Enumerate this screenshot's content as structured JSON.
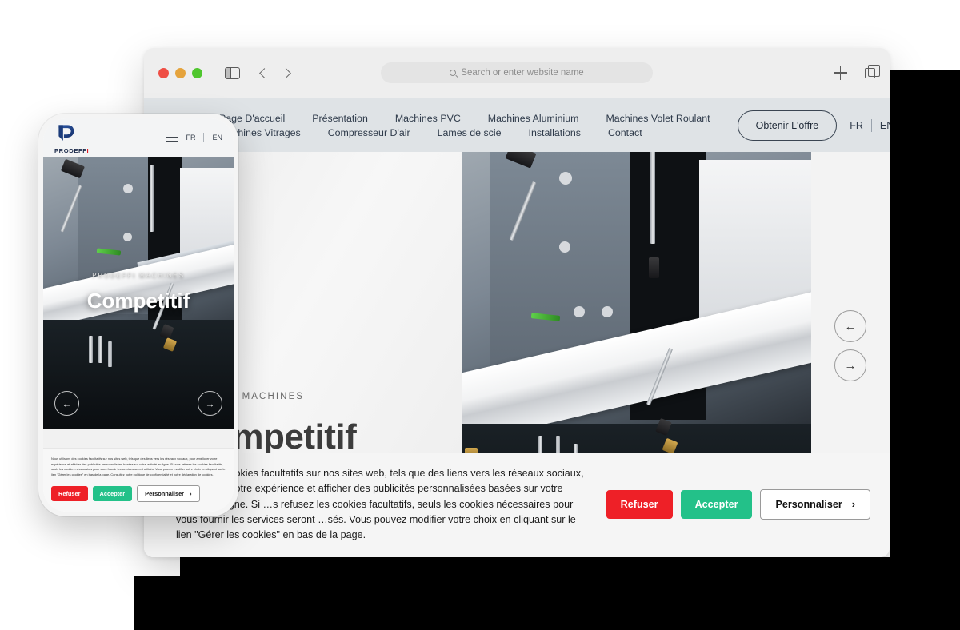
{
  "browser": {
    "window_controls": [
      "close",
      "minimize",
      "zoom"
    ],
    "sidebar_icon": "sidebar-icon",
    "back_icon": "chevron-left-icon",
    "forward_icon": "chevron-right-icon",
    "address_bar": {
      "placeholder": "Search or enter website name",
      "value": "",
      "search_icon": "search-icon"
    },
    "new_tab_icon": "plus-icon",
    "tab_overview_icon": "tab-overview-icon"
  },
  "site": {
    "logo_alt": "PRODEFFI",
    "nav_row1": [
      {
        "label": "Page D'accueil"
      },
      {
        "label": "Présentation"
      },
      {
        "label": "Machines PVC"
      },
      {
        "label": "Machines Aluminium"
      },
      {
        "label": "Machines Volet Roulant"
      }
    ],
    "nav_row2": [
      {
        "label": "Machines Vitrages"
      },
      {
        "label": "Compresseur D'air"
      },
      {
        "label": "Lames de scie"
      },
      {
        "label": "Installations"
      },
      {
        "label": "Contact"
      }
    ],
    "cta_label": "Obtenir L'offre",
    "lang_fr": "FR",
    "lang_en": "EN",
    "hero": {
      "eyebrow": "EFFI MACHINES",
      "headline": "ompetitif",
      "prev_icon": "arrow-left-icon",
      "next_icon": "arrow-right-icon",
      "prev_glyph": "←",
      "next_glyph": "→"
    },
    "cookie": {
      "text": "…ons des cookies facultatifs sur nos sites web, tels que des liens vers les réseaux sociaux, pour …orer votre expérience et afficher des publicités personnalisées basées sur votre activité en ligne. Si …s refusez les cookies facultatifs, seuls les cookies nécessaires pour vous fournir les services seront …sés. Vous pouvez modifier votre choix en cliquant sur le lien \"Gérer les cookies\" en bas de la page.",
      "refuse_label": "Refuser",
      "accept_label": "Accepter",
      "customize_label": "Personnaliser",
      "customize_chevron": "›"
    }
  },
  "phone": {
    "logo_text": "PRODEFF",
    "logo_dot": "I",
    "menu_icon": "hamburger-menu-icon",
    "lang_fr": "FR",
    "lang_en": "EN",
    "hero": {
      "eyebrow": "PRODEFFI MACHINES",
      "headline": "Competitif",
      "prev_glyph": "←",
      "next_glyph": "→"
    },
    "cookie": {
      "text": "Nous utilisons des cookies facultatifs sur nos sites web, tels que des liens vers les réseaux sociaux, pour améliorer votre expérience et afficher des publicités personnalisées basées sur votre activité en ligne. Si vous refusez les cookies facultatifs, seuls les cookies nécessaires pour vous fournir les services seront utilisés. Vous pouvez modifier votre choix en cliquant sur le lien \"Gérer les cookies\" en bas de la page. Consultez notre politique de confidentialité et notre déclaration de cookies.",
      "refuse_label": "Refuser",
      "accept_label": "Accepter",
      "customize_label": "Personnaliser",
      "customize_chevron": "›"
    }
  },
  "colors": {
    "refuse_red": "#ee2027",
    "accept_green": "#23c189",
    "brand_blue": "#1b3b7a",
    "site_header_bg": "#dfe3e6",
    "chrome_bg": "#eeeeee"
  }
}
